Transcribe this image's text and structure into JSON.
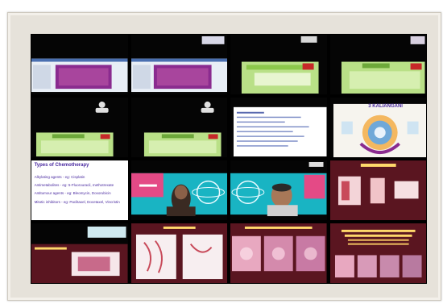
{
  "tiles": [
    {
      "id": "r1c1",
      "type": "slide-purple-bar"
    },
    {
      "id": "r1c2",
      "type": "slide-purple-bar"
    },
    {
      "id": "r1c3",
      "type": "slide-green"
    },
    {
      "id": "r1c4",
      "type": "slide-green"
    },
    {
      "id": "r2c1",
      "type": "avatar-green-slide"
    },
    {
      "id": "r2c2",
      "type": "avatar-green-slide"
    },
    {
      "id": "r2c3",
      "type": "slide-text-list"
    },
    {
      "id": "r2c4",
      "type": "slide-diagram",
      "title": "3 KALIANGANI"
    },
    {
      "id": "r3c1",
      "type": "slide-chemo"
    },
    {
      "id": "r3c2",
      "type": "video-banner"
    },
    {
      "id": "r3c3",
      "type": "video-banner"
    },
    {
      "id": "r3c4",
      "type": "slide-maroon"
    },
    {
      "id": "r4c1",
      "type": "slide-maroon"
    },
    {
      "id": "r4c2",
      "type": "slide-maroon"
    },
    {
      "id": "r4c3",
      "type": "slide-maroon"
    },
    {
      "id": "r4c4",
      "type": "slide-maroon"
    }
  ],
  "chemo_slide": {
    "title": "Types of Chemotherapy",
    "lines": [
      "Alkylating agents - eg: Cisplatin",
      "Antimetabolites - eg: 5-Fluorouracil, methotrexate",
      "Antitumour agents - eg: Bleomycin, Doxorubicin",
      "Mitotic inhibitors - eg: Paclitaxel, Docetaxel, Vincristin"
    ]
  },
  "colors": {
    "maroon": "#5a1520",
    "teal": "#19b4c3",
    "purple": "#8a2b8f",
    "green": "#b9e087"
  }
}
